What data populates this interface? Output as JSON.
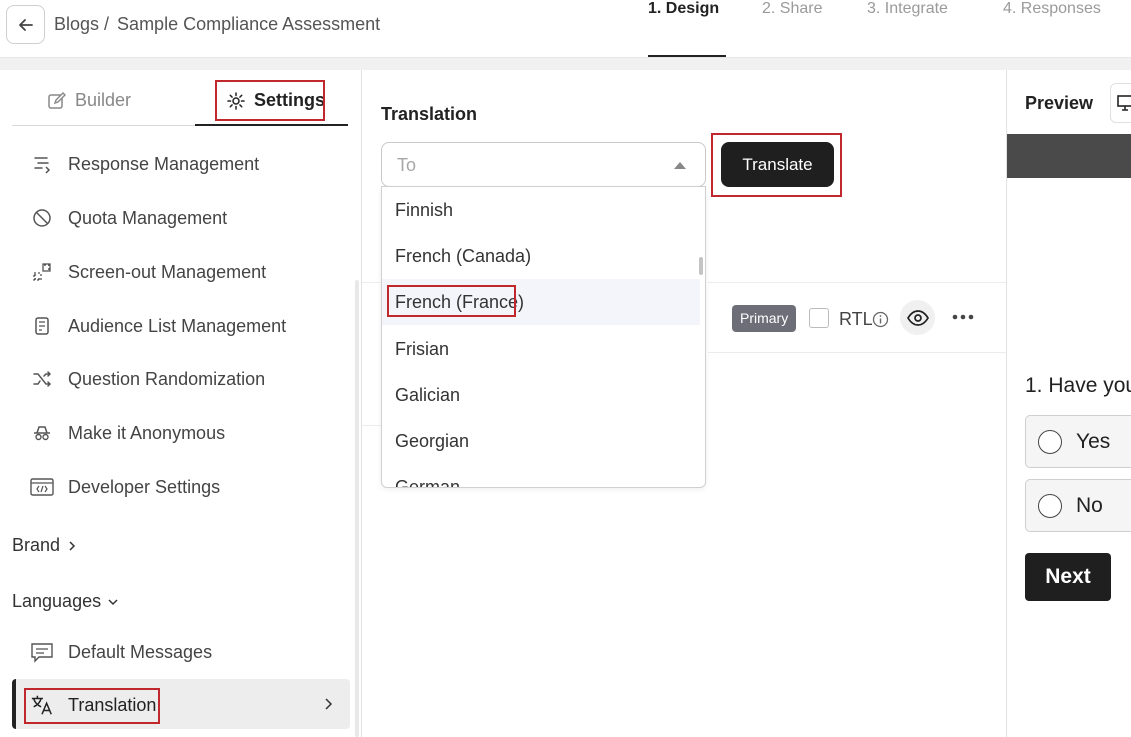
{
  "header": {
    "breadcrumb_root": "Blogs",
    "breadcrumb_sep": "/",
    "breadcrumb_current": "Sample Compliance Assessment",
    "steps": [
      "1. Design",
      "2. Share",
      "3. Integrate",
      "4. Responses"
    ]
  },
  "sidebar": {
    "tabs": {
      "builder": "Builder",
      "settings": "Settings"
    },
    "items": [
      {
        "label": "Response Management",
        "icon": "response-management-icon"
      },
      {
        "label": "Quota Management",
        "icon": "quota-management-icon"
      },
      {
        "label": "Screen-out Management",
        "icon": "screen-out-icon"
      },
      {
        "label": "Audience List Management",
        "icon": "audience-list-icon"
      },
      {
        "label": "Question Randomization",
        "icon": "shuffle-icon"
      },
      {
        "label": "Make it Anonymous",
        "icon": "anonymous-icon"
      },
      {
        "label": "Developer Settings",
        "icon": "code-icon"
      }
    ],
    "brand_label": "Brand",
    "languages_label": "Languages",
    "language_items": [
      {
        "label": "Default Messages",
        "icon": "message-icon"
      },
      {
        "label": "Translation",
        "icon": "translate-icon"
      }
    ]
  },
  "translation": {
    "title": "Translation",
    "placeholder": "To",
    "translate_button": "Translate",
    "options": [
      "Finnish",
      "French (Canada)",
      "French (France)",
      "Frisian",
      "Galician",
      "Georgian",
      "German"
    ],
    "highlighted": "French (France)",
    "primary_badge": "Primary",
    "rtl_label": "RTL"
  },
  "preview": {
    "label": "Preview",
    "question": "1. Have you",
    "choices": [
      "Yes",
      "No"
    ],
    "next_button": "Next"
  },
  "colors": {
    "accent_dark": "#1f1f1f",
    "annotation_red": "#c0282d",
    "badge_gray": "#6e6e78"
  }
}
